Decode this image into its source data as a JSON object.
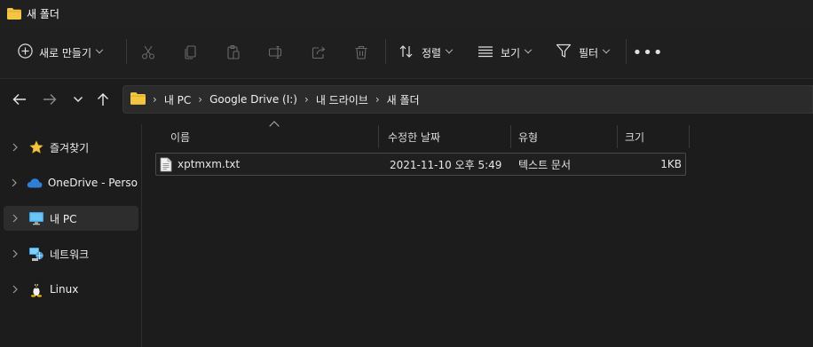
{
  "window": {
    "title": "새 폴더"
  },
  "toolbar": {
    "new_label": "새로 만들기",
    "sort_label": "정렬",
    "view_label": "보기",
    "filter_label": "필터",
    "more_label": "•••"
  },
  "address": {
    "crumbs": [
      "내 PC",
      "Google Drive (I:)",
      "내 드라이브",
      "새 폴더"
    ],
    "separator": "›"
  },
  "sidebar": {
    "items": [
      {
        "label": "즐겨찾기",
        "icon": "star-icon"
      },
      {
        "label": "OneDrive - Persona",
        "icon": "cloud-icon"
      },
      {
        "label": "내 PC",
        "icon": "monitor-icon",
        "active": true
      },
      {
        "label": "네트워크",
        "icon": "network-icon"
      },
      {
        "label": "Linux",
        "icon": "linux-icon"
      }
    ]
  },
  "columns": [
    "이름",
    "수정한 날짜",
    "유형",
    "크기"
  ],
  "files": [
    {
      "name": "xptmxm.txt",
      "modified": "2021-11-10 오후 5:49",
      "type": "텍스트 문서",
      "size": "1KB"
    }
  ],
  "colors": {
    "folder": "#f4c542",
    "accent": "#4cc2ff",
    "background": "#1c1c1c"
  }
}
